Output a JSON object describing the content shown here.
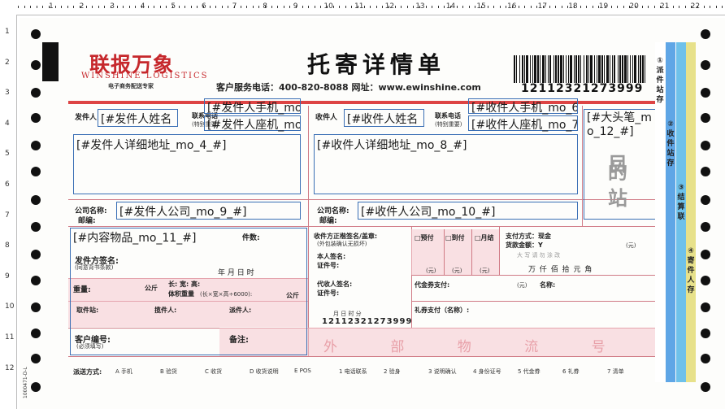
{
  "ruler": {
    "top_numbers": [
      "1",
      "2",
      "3",
      "4",
      "5",
      "6",
      "7",
      "8",
      "9",
      "10",
      "11",
      "12",
      "13",
      "14",
      "15",
      "16",
      "17",
      "18",
      "19",
      "20",
      "21",
      "22"
    ],
    "left_numbers": [
      "1",
      "2",
      "3",
      "4",
      "5",
      "6",
      "7",
      "8",
      "9",
      "10",
      "11",
      "12"
    ]
  },
  "header": {
    "logo_cn": "联报万象",
    "logo_en": "WINSHINE LOGISTICS",
    "logo_sub": "电子商务配送专家",
    "title": "托寄详情单",
    "service": "客户服务电话：400-820-8088   网址：www.ewinshine.com",
    "tracking_number": "12112321273999"
  },
  "sender": {
    "label": "发件人",
    "contact_label": "联系电话",
    "contact_sub": "(特别重要)",
    "name_field": "[#发件人姓名",
    "mobile_field": "[#发件人手机_mo",
    "phone_field": "[#发件人座机_mo",
    "address_field": "[#发件人详细地址_mo_4_#]",
    "company_label": "公司名称:",
    "postcode_label": "邮编:",
    "company_field": "[#发件人公司_mo_9_#]"
  },
  "receiver": {
    "label": "收件人",
    "contact_label": "联系电话",
    "contact_sub": "(特别重要)",
    "name_field": "[#收件人姓名",
    "mobile_field": "[#收件人手机_mo_6",
    "phone_field": "[#收件人座机_mo_7",
    "address_field": "[#收件人详细地址_mo_8_#]",
    "company_label": "公司名称:",
    "postcode_label": "邮编:",
    "company_field": "[#收件人公司_mo_10_#]"
  },
  "big_pen": {
    "field": "[#大头笔_mo_12_#]",
    "stamp": [
      "目",
      "的",
      "站"
    ]
  },
  "goods": {
    "field": "[#内容物品_mo_11_#]",
    "count_label": "件数:",
    "sign_label": "发件方签名:",
    "sign_sub": "(同意背书条款)",
    "date_label": "年   月   日   时",
    "weight_label": "重量:",
    "weight_unit": "公斤",
    "dims_label": "长:       宽:       高:",
    "vol_label": "体积重量",
    "vol_sub": "(长×宽×高÷6000):",
    "vol_unit": "公斤",
    "pickup_label": "取件站:",
    "collector_label": "揽件人:",
    "dispatcher_label": "派件人:",
    "customer_label": "客户编号:",
    "customer_sub": "(必须填写)",
    "remark_label": "备注:"
  },
  "receipt": {
    "recv_sign_label": "收件方正楷签名/盖章:",
    "recv_sign_sub": "(外包装确认无损坏)",
    "self_sign_label": "本人签名:",
    "id_label": "证件号:",
    "proxy_sign_label": "代收人签名:",
    "proxy_id_label": "证件号:",
    "time_label": "月   日   时   分",
    "receipt_number": "12112321273999",
    "pay_options": [
      "□预付",
      "□到付",
      "□月结"
    ],
    "unit_yuan": "(元)",
    "payment_label": "支付方式：现金",
    "cod_label": "货款金额：Y",
    "cod_unit": "(元)",
    "cod_stamp": "大 写 请 勿 涂 改",
    "amount_units": "万   仟   佰   拾   元   角",
    "voucher_label": "代金券支付:",
    "voucher_unit": "(元)",
    "name_label": "名称:",
    "gift_label": "礼券支付（名称）:",
    "external_label": "外   部   物   流   号"
  },
  "delivery": {
    "label": "派送方式:",
    "options": [
      "A 手机",
      "B 验货",
      "C 收货",
      "D 收货说明",
      "E POS",
      "1 电话联系",
      "2 验身",
      "3 说明确认",
      "4 身份证号",
      "5 代金券",
      "6 礼券",
      "7 清单"
    ]
  },
  "side_strips": [
    {
      "num": "①",
      "text": "派件站存",
      "color": "#ffffff"
    },
    {
      "num": "②",
      "text": "收件站存",
      "color": "#5fa6e6"
    },
    {
      "num": "③",
      "text": "结算联",
      "color": "#6ec1ea"
    },
    {
      "num": "④",
      "text": "寄件人存",
      "color": "#e7e18a"
    }
  ],
  "left_margin_code": "1000471-D-L",
  "colors": {
    "accent_red": "#c6282c",
    "field_border": "#3a6fb5",
    "pink": "#f6c9cf"
  }
}
